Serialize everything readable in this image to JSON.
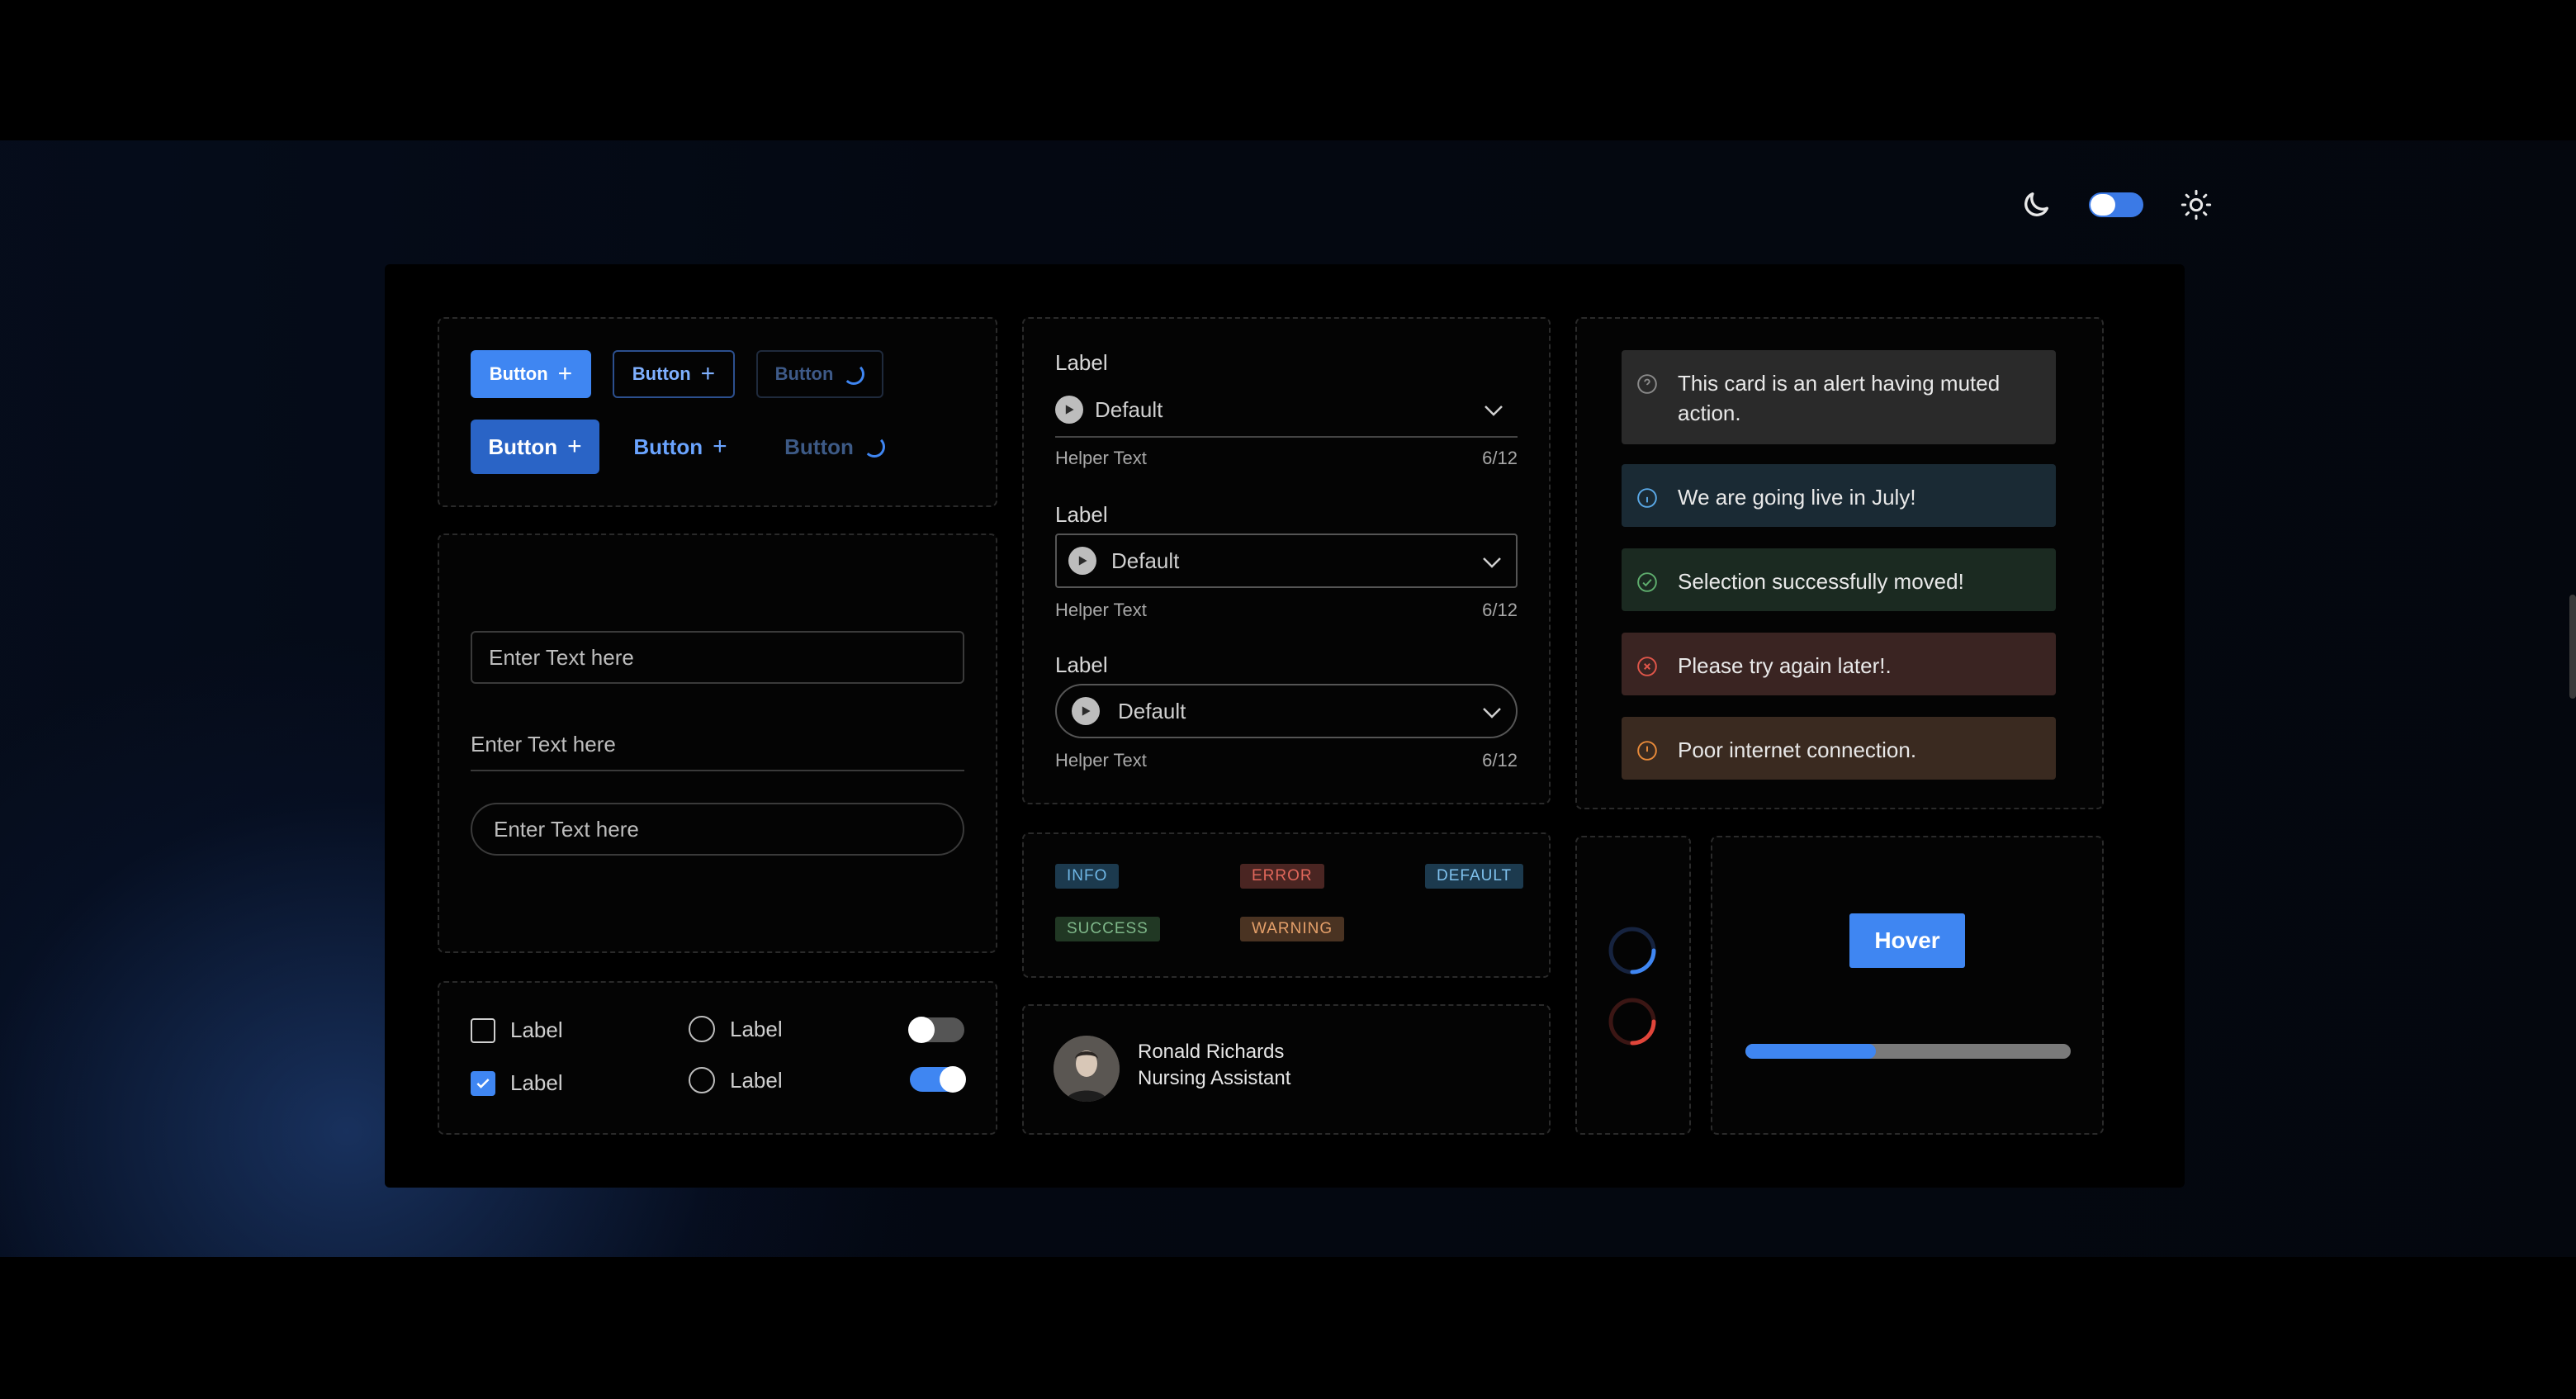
{
  "theme": {
    "mode": "dark"
  },
  "buttons": {
    "small_primary": "Button",
    "small_outline": "Button",
    "small_loading": "Button",
    "large_primary": "Button",
    "large_link": "Button",
    "large_loading": "Button"
  },
  "inputs": {
    "boxed_placeholder": "Enter Text here",
    "underline_placeholder": "Enter Text here",
    "pill_placeholder": "Enter Text here"
  },
  "controls": {
    "checkbox_unchecked_label": "Label",
    "checkbox_checked_label": "Label",
    "radio_1_label": "Label",
    "radio_2_label": "Label",
    "switch_off": false,
    "switch_on": true
  },
  "selects": [
    {
      "label": "Label",
      "value": "Default",
      "helper": "Helper Text",
      "count": "6/12"
    },
    {
      "label": "Label",
      "value": "Default",
      "helper": "Helper Text",
      "count": "6/12"
    },
    {
      "label": "Label",
      "value": "Default",
      "helper": "Helper Text",
      "count": "6/12"
    }
  ],
  "badges": {
    "info": "INFO",
    "error": "ERROR",
    "default": "DEFAULT",
    "success": "SUCCESS",
    "warning": "WARNING"
  },
  "profile": {
    "name": "Ronald Richards",
    "role": "Nursing Assistant"
  },
  "alerts": [
    {
      "type": "muted",
      "icon": "question-icon",
      "text": "This card is an alert having muted action."
    },
    {
      "type": "info",
      "icon": "info-icon",
      "text": "We are going live in July!"
    },
    {
      "type": "success",
      "icon": "check-circle-icon",
      "text": "Selection successfully moved!"
    },
    {
      "type": "error",
      "icon": "x-circle-icon",
      "text": "Please try again later!."
    },
    {
      "type": "warning",
      "icon": "alert-circle-icon",
      "text": "Poor internet connection."
    }
  ],
  "hover_button": {
    "label": "Hover"
  },
  "progress": {
    "value": 0.4
  },
  "colors": {
    "accent": "#3f86f2",
    "info_bg": "#1a2a34",
    "success_bg": "#1b2a21",
    "error_bg": "#3a2422",
    "warning_bg": "#3a2a20",
    "muted_bg": "#2a2a2a"
  }
}
